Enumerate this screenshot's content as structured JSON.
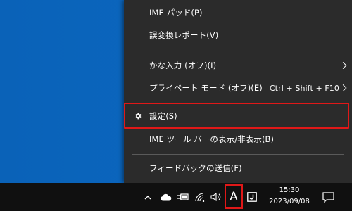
{
  "menu": {
    "items": [
      {
        "label": "IME パッド(P)"
      },
      {
        "label": "誤変換レポート(V)"
      },
      {
        "label": "かな入力 (オフ)(I)"
      },
      {
        "label": "プライベート モード (オフ)(E)",
        "shortcut": "Ctrl + Shift + F10"
      },
      {
        "label": "設定(S)"
      },
      {
        "label": "IME ツール バーの表示/非表示(B)"
      },
      {
        "label": "フィードバックの送信(F)"
      }
    ]
  },
  "taskbar": {
    "ime_mode": "A",
    "clock": {
      "time": "15:30",
      "date": "2023/09/08"
    }
  },
  "colors": {
    "desktop": "#0b68c0",
    "menu_bg": "#2b2b2b",
    "highlight": "#e01818",
    "taskbar": "#101010"
  }
}
